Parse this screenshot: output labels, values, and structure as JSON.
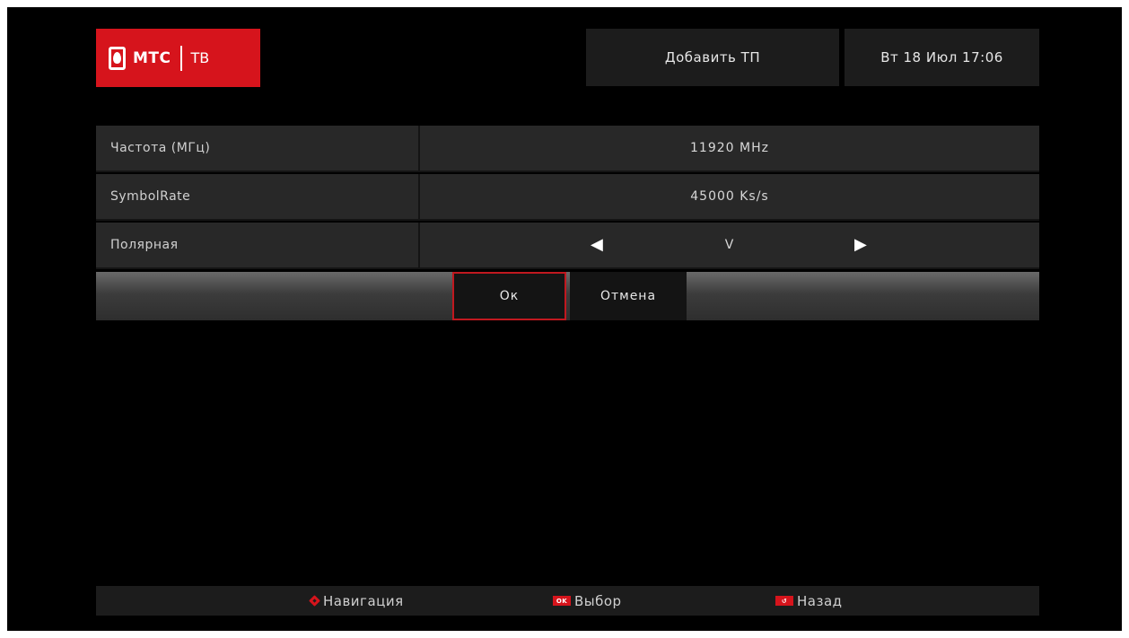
{
  "header": {
    "logo_brand": "МТС",
    "logo_tv": "ТВ",
    "title": "Добавить ТП",
    "datetime": "Вт 18 Июл 17:06"
  },
  "form": {
    "rows": [
      {
        "label": "Частота (МГц)",
        "value": "11920 MHz"
      },
      {
        "label": "SymbolRate",
        "value": "45000 Ks/s"
      },
      {
        "label": "Полярная",
        "value": "V"
      }
    ]
  },
  "buttons": {
    "ok_label": "Ок",
    "cancel_label": "Отмена"
  },
  "footer": {
    "navigation": "Навигация",
    "ok_key": "OK",
    "select": "Выбор",
    "back": "Назад"
  },
  "colors": {
    "accent": "#d6141c",
    "background": "#000000",
    "panel": "#282828"
  }
}
